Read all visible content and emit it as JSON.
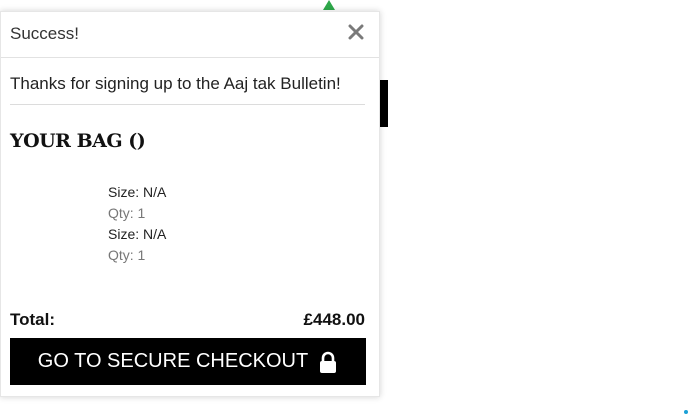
{
  "popup": {
    "title": "Success!",
    "close_glyph": "✕",
    "message": "Thanks for signing up to the Aaj tak Bulletin!"
  },
  "bag": {
    "title": "YOUR BAG ()",
    "items": [
      {
        "size": "Size: N/A",
        "qty": "Qty: 1"
      },
      {
        "size": "Size: N/A",
        "qty": "Qty: 1"
      }
    ],
    "total_label": "Total:",
    "total_value": "£448.00",
    "checkout_label": "GO TO SECURE CHECKOUT"
  },
  "icons": {
    "close": "close-icon",
    "lock": "lock-icon"
  },
  "colors": {
    "checkout_bg": "#000000",
    "checkout_text": "#ffffff",
    "accent_green": "#2ea84a",
    "accent_blue": "#1aa0d6"
  }
}
